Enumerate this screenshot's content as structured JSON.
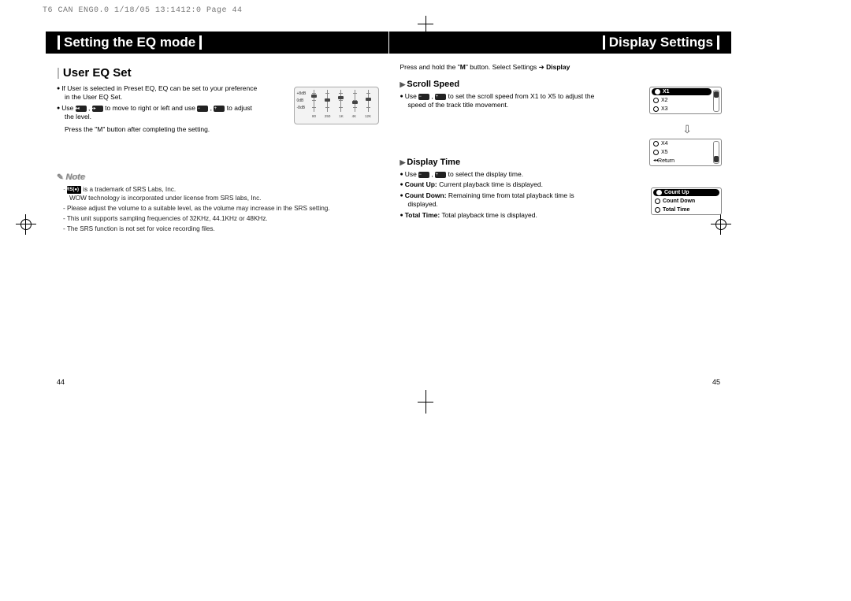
{
  "slug": "T6 CAN ENG0.0  1/18/05 13:1412:0  Page 44",
  "leftPage": {
    "title": "Setting the EQ mode",
    "section": "User EQ Set",
    "bullets": [
      "If User is selected in Preset EQ, EQ can be set to your preference in the User EQ Set.",
      "Use ◂◂ , ▸▸ to move to right or left and use − , + to adjust the level."
    ],
    "afterBullets": "Press the \"M\" button after completing the setting.",
    "noteTitle": "Note",
    "notes": [
      "SRS(●) is a trademark of SRS Labs, Inc.",
      "WOW technology is incorporated under license from SRS labs, Inc.",
      "Please adjust the volume to a suitable level, as the volume may increase in the SRS setting.",
      "This unit supports sampling frequencies of 32KHz, 44.1KHz or 48KHz.",
      "The SRS function is not set for voice recording files."
    ],
    "pageNum": "44",
    "eq": {
      "rows": [
        "+8dB",
        "0dB",
        "-8dB"
      ],
      "cols": [
        "80",
        "250",
        "1K",
        "4K",
        "12K"
      ]
    }
  },
  "rightPage": {
    "title": "Display Settings",
    "instruction": "Press and hold the \"M\" button. Select Settings ➔ Display",
    "scrollSpeed": {
      "heading": "Scroll Speed",
      "bullets": [
        "Use − , + to set the scroll speed from X1 to X5 to adjust the speed of the track title movement."
      ],
      "lcd1": [
        "X1",
        "X2",
        "X3"
      ],
      "lcd2": [
        "X4",
        "X5",
        "Return"
      ]
    },
    "displayTime": {
      "heading": "Display Time",
      "bullets": [
        "Use − , + to select the display time.",
        "Count Up: Current playback time is displayed.",
        "Count Down: Remaining time from total playback time is displayed.",
        "Total Time: Total playback time is displayed."
      ],
      "lcd": [
        "Count Up",
        "Count Down",
        "Total Time"
      ]
    },
    "pageNum": "45"
  }
}
